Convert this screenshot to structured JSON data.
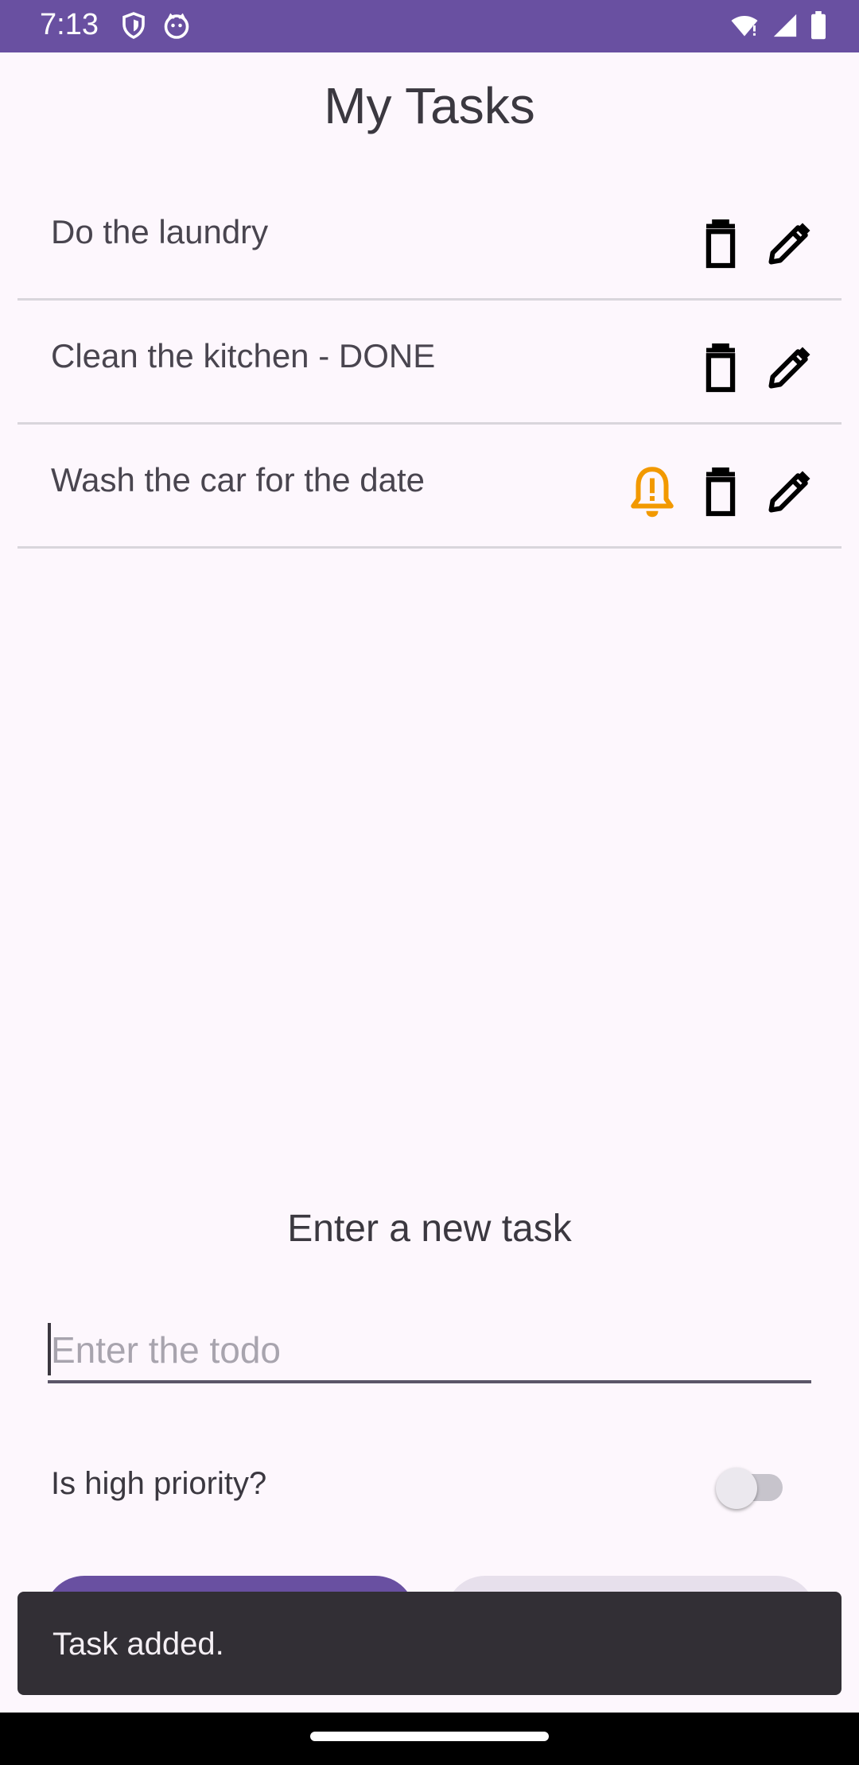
{
  "status_bar": {
    "time": "7:13",
    "left_icons": [
      "shield-icon",
      "cat-icon"
    ],
    "right_icons": [
      "wifi-icon",
      "signal-icon",
      "battery-icon"
    ],
    "bg_color": "#6950a1"
  },
  "app": {
    "title": "My Tasks"
  },
  "tasks": [
    {
      "label": "Do the laundry",
      "high_priority": false
    },
    {
      "label": "Clean the kitchen - DONE",
      "high_priority": false
    },
    {
      "label": "Wash the car for the date",
      "high_priority": true
    }
  ],
  "icons": {
    "priority": "bell-alert-icon",
    "delete": "trash-icon",
    "edit": "pencil-icon",
    "priority_color": "#f29900"
  },
  "new_task": {
    "heading": "Enter a new task",
    "input_placeholder": "Enter the todo",
    "input_value": "",
    "priority_label": "Is high priority?",
    "priority_toggle_on": false
  },
  "snackbar": {
    "message": "Task added."
  },
  "colors": {
    "accent": "#6950a1",
    "background": "#fdf7fd",
    "snackbar_bg": "#322f35"
  }
}
